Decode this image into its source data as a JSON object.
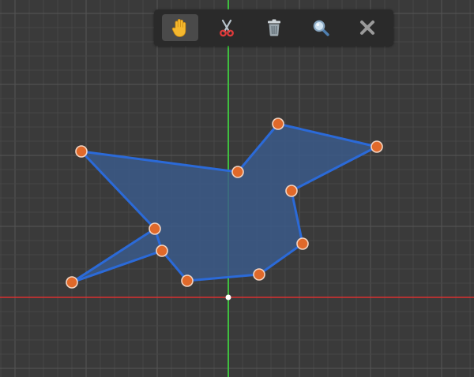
{
  "toolbar": {
    "tools": [
      {
        "id": "pan",
        "icon": "hand-icon",
        "active": true
      },
      {
        "id": "cut",
        "icon": "scissors-icon",
        "active": false
      },
      {
        "id": "delete",
        "icon": "trash-icon",
        "active": false
      },
      {
        "id": "zoom",
        "icon": "magnifier-icon",
        "active": false
      },
      {
        "id": "close",
        "icon": "close-x-icon",
        "active": false
      }
    ]
  },
  "canvas": {
    "background": "#3a3a3a",
    "grid_minor_color": "#474747",
    "grid_major_color": "#555555",
    "y_axis_color": "#3fbf3f",
    "x_axis_color": "#d93030",
    "origin_color": "#ffffff"
  },
  "polygon": {
    "fill": "#3b5a8a",
    "stroke": "#2b6ad8",
    "vertex_fill": "#e0692a",
    "vertex_stroke": "#f2d4c2"
  }
}
